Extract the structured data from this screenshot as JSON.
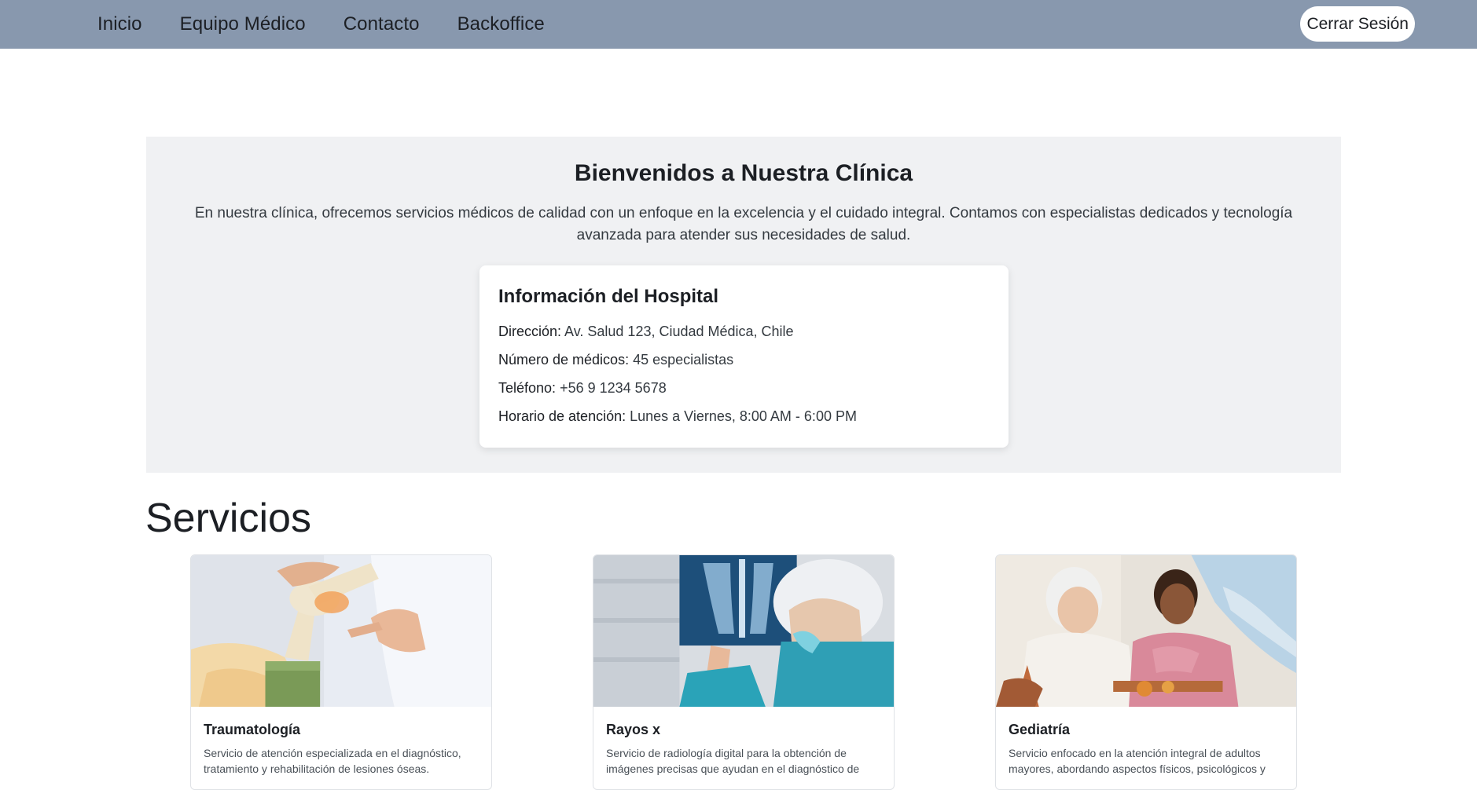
{
  "nav": {
    "links": [
      "Inicio",
      "Equipo Médico",
      "Contacto",
      "Backoffice"
    ],
    "logout_label": "Cerrar Sesión",
    "bg_color": "#8898ae"
  },
  "hero": {
    "title": "Bienvenidos a Nuestra Clínica",
    "text": "En nuestra clínica, ofrecemos servicios médicos de calidad con un enfoque en la excelencia y el cuidado integral. Contamos con especialistas dedicados y tecnología avanzada para atender sus necesidades de salud."
  },
  "hospital_info": {
    "title": "Información del Hospital",
    "rows": [
      {
        "label": "Dirección:",
        "value": "Av. Salud 123, Ciudad Médica, Chile"
      },
      {
        "label": "Número de médicos:",
        "value": "45 especialistas"
      },
      {
        "label": "Teléfono:",
        "value": "+56 9 1234 5678"
      },
      {
        "label": "Horario de atención:",
        "value": "Lunes a Viernes, 8:00 AM - 6:00 PM"
      }
    ]
  },
  "services": {
    "title": "Servicios",
    "items": [
      {
        "name": "Traumatología",
        "description": "Servicio de atención especializada en el diagnóstico, tratamiento y rehabilitación de lesiones óseas.",
        "image": "knee-joint-model-photo"
      },
      {
        "name": "Rayos x",
        "description": "Servicio de radiología digital para la obtención de imágenes precisas que ayudan en el diagnóstico de",
        "image": "xray-review-photo"
      },
      {
        "name": "Gediatría",
        "description": "Servicio enfocado en la atención integral de adultos mayores, abordando aspectos físicos, psicológicos y",
        "image": "elderly-care-photo"
      }
    ]
  }
}
